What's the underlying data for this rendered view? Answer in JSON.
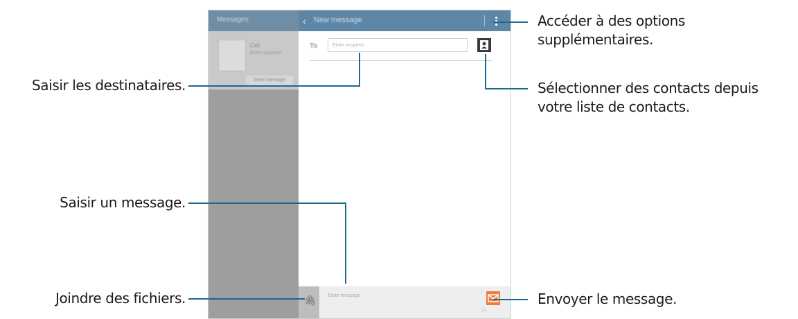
{
  "left_panel": {
    "title": "Messages",
    "card_name": "Call",
    "card_number": "Enter recipient",
    "card_button": "Send message"
  },
  "compose": {
    "title": "New message",
    "to_label": "To",
    "recipient_placeholder": "Enter recipient",
    "message_placeholder": "Enter message",
    "counter": "0/1"
  },
  "callouts": {
    "options": [
      "Accéder à des options",
      "supplémentaires."
    ],
    "recipients": "Saisir les destinataires.",
    "contacts": [
      "Sélectionner des contacts depuis",
      "votre liste de contacts."
    ],
    "message": "Saisir un message.",
    "attach": "Joindre des fichiers.",
    "send": "Envoyer le message."
  },
  "colors": {
    "action_bar": "#5e87a7",
    "callout_line": "#1a6a92",
    "send_button": "#f07b3f"
  }
}
